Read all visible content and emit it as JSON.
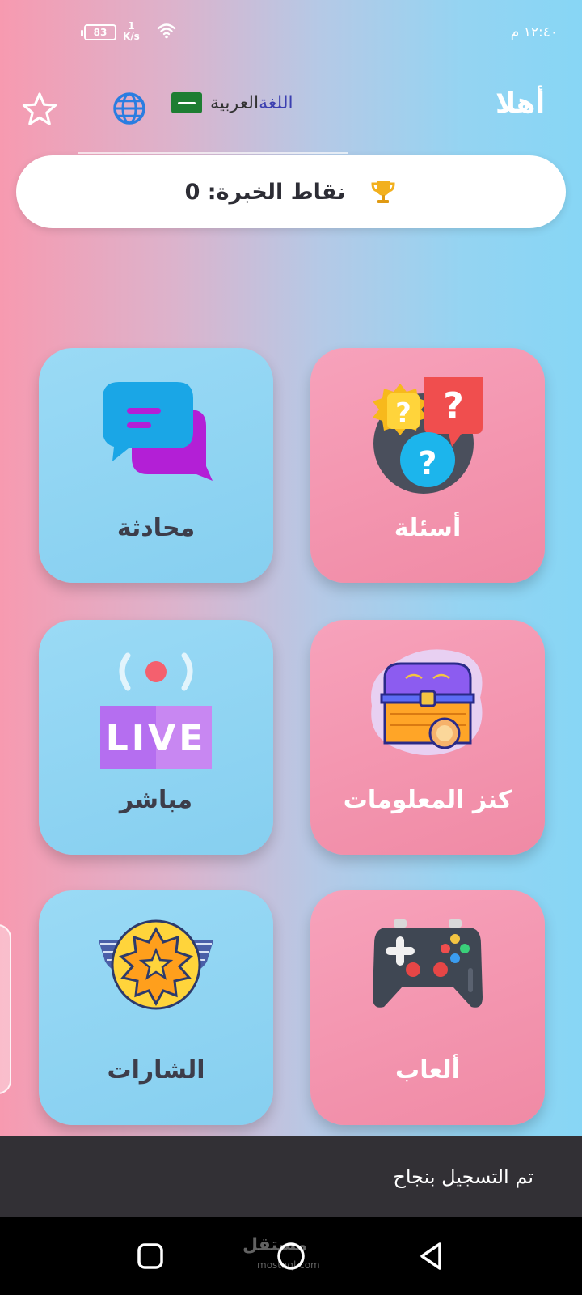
{
  "status_bar": {
    "battery": "83",
    "net_speed_value": "1",
    "net_speed_unit": "K/s",
    "clock": "١٢:٤٠ م"
  },
  "header": {
    "greeting": "أهلا",
    "language_prefix": "اللغة",
    "language_name": "العربية",
    "star_icon": "star-outline-icon",
    "globe_icon": "globe-icon"
  },
  "xp": {
    "label": "نقاط الخبرة: 0",
    "icon": "trophy-icon"
  },
  "cards": [
    {
      "label": "أسئلة",
      "icon": "questions-icon",
      "theme": "pink"
    },
    {
      "label": "محادثة",
      "icon": "chat-icon",
      "theme": "blue"
    },
    {
      "label": "كنز المعلومات",
      "icon": "treasure-chest-icon",
      "theme": "pink"
    },
    {
      "label": "مباشر",
      "icon": "live-icon",
      "icon_text": "LIVE",
      "theme": "blue"
    },
    {
      "label": "ألعاب",
      "icon": "gamepad-icon",
      "theme": "pink"
    },
    {
      "label": "الشارات",
      "icon": "badge-icon",
      "theme": "blue"
    }
  ],
  "toast": {
    "message": "تم التسجيل بنجاح"
  },
  "navbar": {
    "watermark": "مستقل",
    "watermark_sub": "mostaql.com"
  },
  "colors": {
    "pink_card": "#f08aa5",
    "blue_card": "#86cff0",
    "toast_bg": "#323035",
    "trophy": "#f2b01e"
  }
}
